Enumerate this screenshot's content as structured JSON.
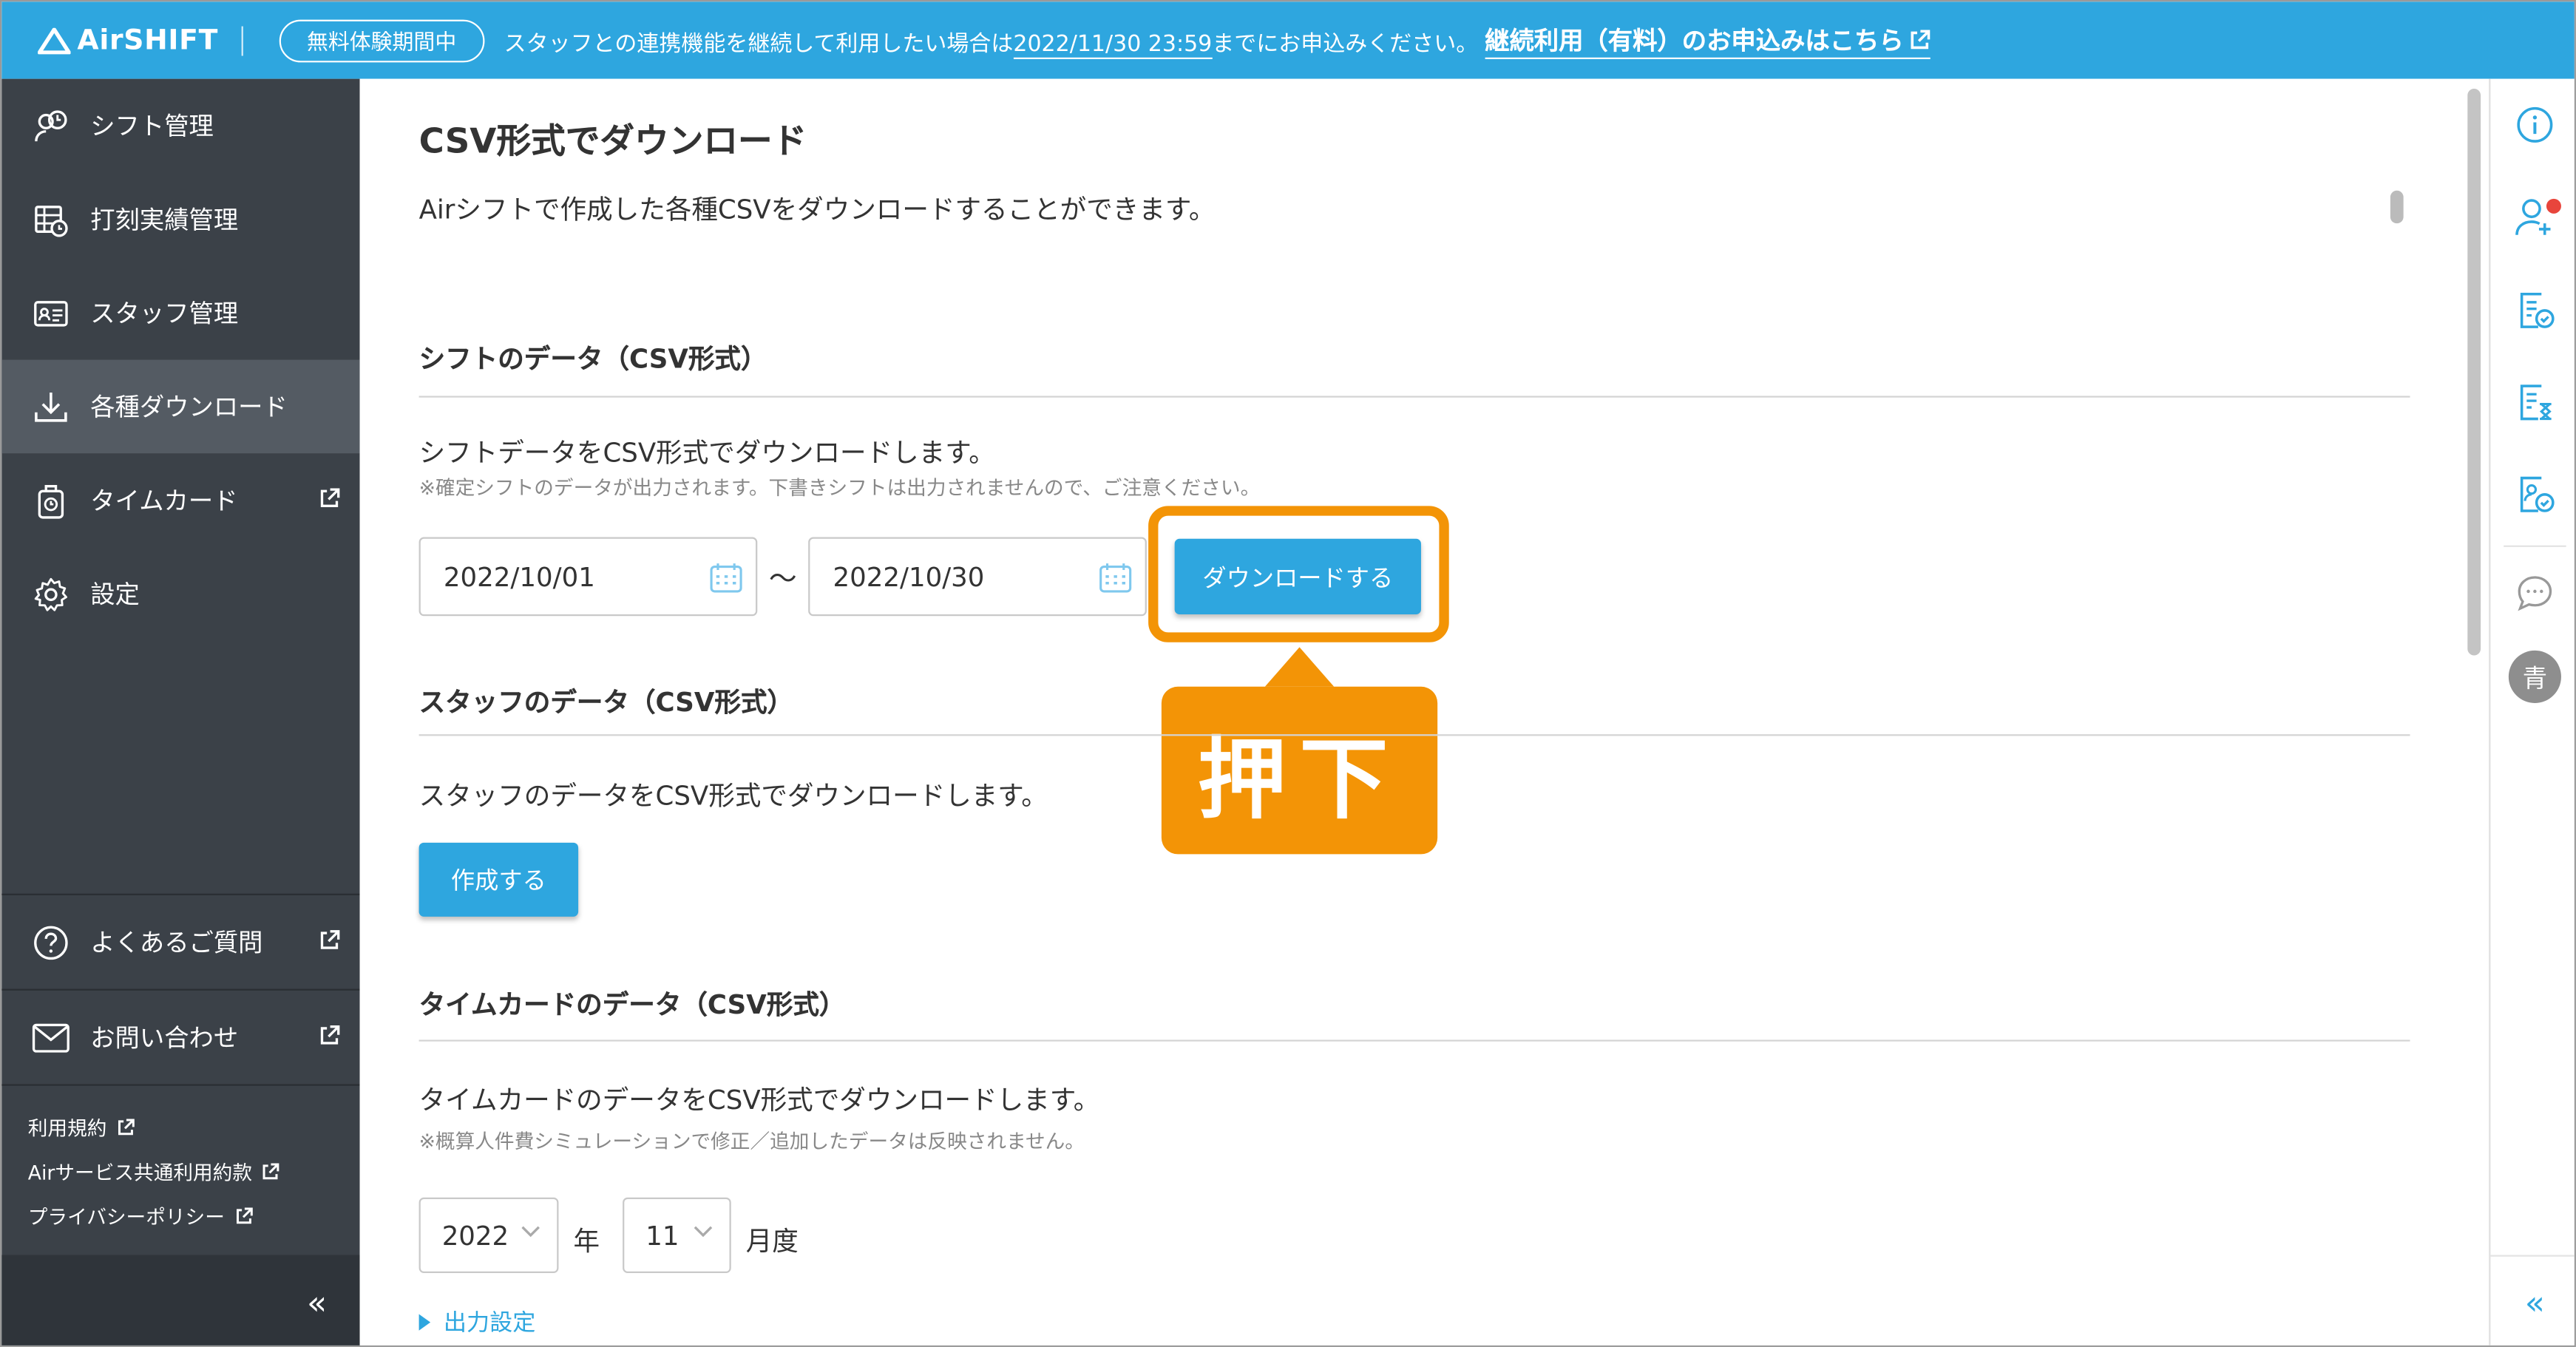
{
  "banner": {
    "logo": "AirSHIFT",
    "trial_badge": "無料体験期間中",
    "message_before": "スタッフとの連携機能を継続して利用したい場合は",
    "deadline": "2022/11/30 23:59",
    "message_after": "までにお申込みください。",
    "link": "継続利用（有料）のお申込みはこちら"
  },
  "sidebar": {
    "items": [
      {
        "label": "シフト管理",
        "icon": "shift-icon"
      },
      {
        "label": "打刻実績管理",
        "icon": "clock-record-icon"
      },
      {
        "label": "スタッフ管理",
        "icon": "staff-card-icon"
      },
      {
        "label": "各種ダウンロード",
        "icon": "download-icon",
        "active": true
      },
      {
        "label": "タイムカード",
        "icon": "timecard-icon",
        "external": true
      },
      {
        "label": "設定",
        "icon": "gear-icon"
      }
    ],
    "help": [
      {
        "label": "よくあるご質問",
        "icon": "question-icon",
        "external": true
      },
      {
        "label": "お問い合わせ",
        "icon": "mail-icon",
        "external": true
      }
    ],
    "links": [
      {
        "label": "利用規約"
      },
      {
        "label": "Airサービス共通利用約款"
      },
      {
        "label": "プライバシーポリシー"
      }
    ],
    "collapse": "«"
  },
  "main": {
    "title": "CSV形式でダウンロード",
    "description": "Airシフトで作成した各種CSVをダウンロードすることができます。",
    "shift": {
      "heading": "シフトのデータ（CSV形式）",
      "description": "シフトデータをCSV形式でダウンロードします。",
      "note": "※確定シフトのデータが出力されます。下書きシフトは出力されませんので、ご注意ください。",
      "start_date": "2022/10/01",
      "separator": "〜",
      "end_date": "2022/10/30",
      "button": "ダウンロードする"
    },
    "staff": {
      "heading": "スタッフのデータ（CSV形式）",
      "description": "スタッフのデータをCSV形式でダウンロードします。",
      "button": "作成する"
    },
    "timecard": {
      "heading": "タイムカードのデータ（CSV形式）",
      "description": "タイムカードのデータをCSV形式でダウンロードします。",
      "note": "※概算人件費シミュレーションで修正／追加したデータは反映されません。",
      "year": "2022",
      "year_unit": "年",
      "month": "11",
      "month_unit": "月度",
      "output_settings": "出力設定"
    }
  },
  "annotation": {
    "callout": "押下",
    "color": "#f39406"
  },
  "rail": {
    "avatar": "青",
    "collapse": "«"
  },
  "colors": {
    "accent": "#2ea6df",
    "sidebar": "#3b4148",
    "highlight": "#f39406"
  }
}
